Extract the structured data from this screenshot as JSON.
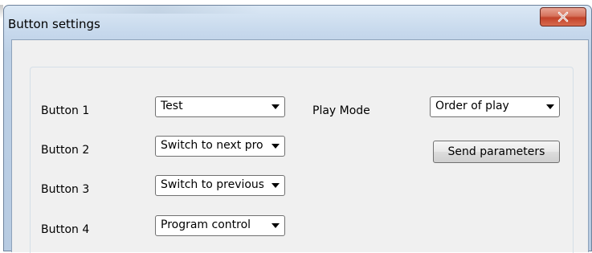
{
  "window": {
    "title": "Button settings",
    "close_icon": "close-icon"
  },
  "settings": {
    "rows": [
      {
        "label": "Button 1",
        "value": "Test"
      },
      {
        "label": "Button 2",
        "value": "Switch to next prog"
      },
      {
        "label": "Button 3",
        "value": "Switch to previous |"
      },
      {
        "label": "Button 4",
        "value": "Program control"
      }
    ],
    "play_mode": {
      "label": "Play Mode",
      "value": "Order of play"
    },
    "send_button": "Send parameters"
  },
  "colors": {
    "close_red": "#c2432a",
    "frame_blue": "#bcd0e6",
    "client_bg": "#f0f0f0"
  }
}
